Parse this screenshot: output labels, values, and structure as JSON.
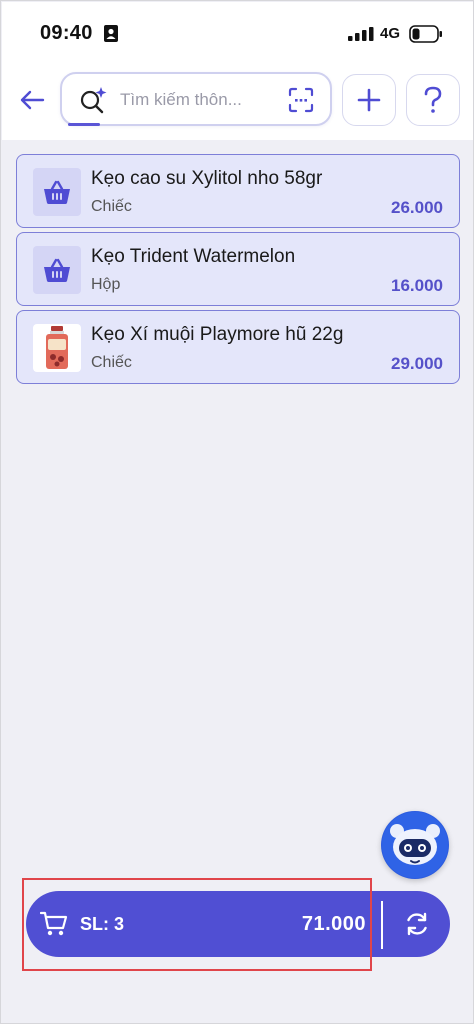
{
  "status_bar": {
    "time": "09:40",
    "network": "4G"
  },
  "header": {
    "search": {
      "placeholder": "Tìm kiếm thôn..."
    }
  },
  "products": [
    {
      "name": "Kẹo cao su Xylitol nho 58gr",
      "unit": "Chiếc",
      "price": "26.000",
      "thumb": "basket-icon"
    },
    {
      "name": "Kẹo Trident Watermelon",
      "unit": "Hộp",
      "price": "16.000",
      "thumb": "basket-icon"
    },
    {
      "name": "Kẹo Xí muội Playmore hũ 22g",
      "unit": "Chiếc",
      "price": "29.000",
      "thumb": "product-photo"
    }
  ],
  "cart": {
    "qty_label": "SL: 3",
    "total": "71.000"
  },
  "colors": {
    "accent": "#504fd3",
    "card_bg": "#e4e6fa",
    "card_border": "#7d7fd8",
    "price": "#5551c9",
    "highlight": "#e0454a"
  }
}
